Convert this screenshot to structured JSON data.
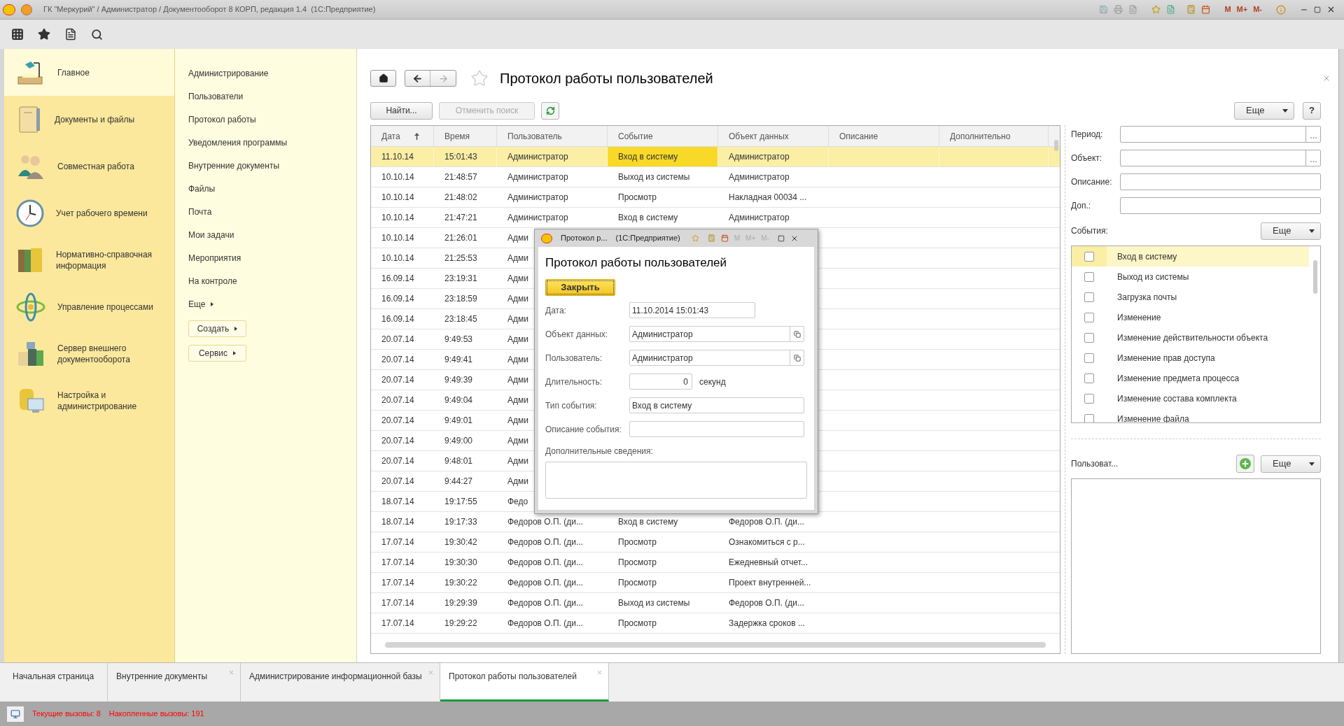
{
  "window": {
    "title": "ГК \"Меркурий\" / Администратор / Документооборот 8 КОРП, редакция 1.4  (1С:Предприятие)",
    "memory_buttons": [
      "M",
      "M+",
      "M-"
    ]
  },
  "sections": [
    {
      "label": "Главное",
      "selected": true
    },
    {
      "label": "Документы и файлы",
      "selected": false
    },
    {
      "label": "Совместная работа",
      "selected": false
    },
    {
      "label": "Учет рабочего времени",
      "selected": false
    },
    {
      "label": "Нормативно-справочная информация",
      "selected": false
    },
    {
      "label": "Управление процессами",
      "selected": false
    },
    {
      "label": "Сервер внешнего документооборота",
      "selected": false
    },
    {
      "label": "Настройка и администрирование",
      "selected": false
    }
  ],
  "nav": {
    "links": [
      "Администрирование",
      "Пользователи",
      "Протокол работы",
      "Уведомления программы",
      "Внутренние документы",
      "Файлы",
      "Почта",
      "Мои задачи",
      "Мероприятия",
      "На контроле"
    ],
    "more": "Еще",
    "buttons": [
      "Создать",
      "Сервис"
    ]
  },
  "page": {
    "title": "Протокол работы пользователей"
  },
  "toolbar": {
    "find": "Найти...",
    "cancel_search": {
      "label": "Отменить поиск",
      "disabled": true
    },
    "more": "Еще",
    "help": "?"
  },
  "table": {
    "columns": [
      {
        "label": "Дата",
        "sorted": true
      },
      {
        "label": "Время",
        "sorted": false
      },
      {
        "label": "Пользователь",
        "sorted": false
      },
      {
        "label": "Событие",
        "sorted": false
      },
      {
        "label": "Объект данных",
        "sorted": false
      },
      {
        "label": "Описание",
        "sorted": false
      },
      {
        "label": "Дополнительно",
        "sorted": false
      }
    ],
    "rows": [
      {
        "date": "11.10.14",
        "time": "15:01:43",
        "user": "Администратор",
        "event": "Вход в систему",
        "object": "Администратор",
        "selected": true
      },
      {
        "date": "10.10.14",
        "time": "21:48:57",
        "user": "Администратор",
        "event": "Выход из системы",
        "object": "Администратор",
        "selected": false
      },
      {
        "date": "10.10.14",
        "time": "21:48:02",
        "user": "Администратор",
        "event": "Просмотр",
        "object": "Накладная 00034 ...",
        "selected": false
      },
      {
        "date": "10.10.14",
        "time": "21:47:21",
        "user": "Администратор",
        "event": "Вход в систему",
        "object": "Администратор",
        "selected": false
      },
      {
        "date": "10.10.14",
        "time": "21:26:01",
        "user": "Адми",
        "selected": false
      },
      {
        "date": "10.10.14",
        "time": "21:25:53",
        "user": "Адми",
        "selected": false
      },
      {
        "date": "16.09.14",
        "time": "23:19:31",
        "user": "Адми",
        "selected": false
      },
      {
        "date": "16.09.14",
        "time": "23:18:59",
        "user": "Адми",
        "selected": false
      },
      {
        "date": "16.09.14",
        "time": "23:18:45",
        "user": "Адми",
        "selected": false
      },
      {
        "date": "20.07.14",
        "time": "9:49:53",
        "user": "Адми",
        "selected": false
      },
      {
        "date": "20.07.14",
        "time": "9:49:41",
        "user": "Адми",
        "selected": false
      },
      {
        "date": "20.07.14",
        "time": "9:49:39",
        "user": "Адми",
        "selected": false
      },
      {
        "date": "20.07.14",
        "time": "9:49:04",
        "user": "Адми",
        "selected": false
      },
      {
        "date": "20.07.14",
        "time": "9:49:01",
        "user": "Адми",
        "selected": false
      },
      {
        "date": "20.07.14",
        "time": "9:49:00",
        "user": "Адми",
        "selected": false
      },
      {
        "date": "20.07.14",
        "time": "9:48:01",
        "user": "Адми",
        "selected": false
      },
      {
        "date": "20.07.14",
        "time": "9:44:27",
        "user": "Адми",
        "selected": false
      },
      {
        "date": "18.07.14",
        "time": "19:17:55",
        "user": "Федо",
        "selected": false
      },
      {
        "date": "18.07.14",
        "time": "19:17:33",
        "user": "Федоров О.П. (ди...",
        "event": "Вход в систему",
        "object": "Федоров О.П. (ди...",
        "selected": false
      },
      {
        "date": "17.07.14",
        "time": "19:30:42",
        "user": "Федоров О.П. (ди...",
        "event": "Просмотр",
        "object": "Ознакомиться с р...",
        "selected": false
      },
      {
        "date": "17.07.14",
        "time": "19:30:30",
        "user": "Федоров О.П. (ди...",
        "event": "Просмотр",
        "object": "Ежедневный отчет...",
        "selected": false
      },
      {
        "date": "17.07.14",
        "time": "19:30:22",
        "user": "Федоров О.П. (ди...",
        "event": "Просмотр",
        "object": "Проект внутренней...",
        "selected": false
      },
      {
        "date": "17.07.14",
        "time": "19:29:39",
        "user": "Федоров О.П. (ди...",
        "event": "Выход из системы",
        "object": "Федоров О.П. (ди...",
        "selected": false
      },
      {
        "date": "17.07.14",
        "time": "19:29:22",
        "user": "Федоров О.П. (ди...",
        "event": "Просмотр",
        "object": "Задержка сроков ...",
        "selected": false
      }
    ]
  },
  "filters": [
    {
      "label": "Период:",
      "kind": "choice"
    },
    {
      "label": "Объект:",
      "kind": "choice"
    },
    {
      "label": "Описание:",
      "kind": "text"
    },
    {
      "label": "Доп.:",
      "kind": "text"
    }
  ],
  "events": {
    "label": "События:",
    "more": "Еще",
    "items": [
      {
        "label": "Вход в систему",
        "checked": false,
        "selected": true
      },
      {
        "label": "Выход из системы",
        "checked": false,
        "selected": false
      },
      {
        "label": "Загрузка почты",
        "checked": false,
        "selected": false
      },
      {
        "label": "Изменение",
        "checked": false,
        "selected": false
      },
      {
        "label": "Изменение действительности объекта",
        "checked": false,
        "selected": false
      },
      {
        "label": "Изменение прав доступа",
        "checked": false,
        "selected": false
      },
      {
        "label": "Изменение предмета процесса",
        "checked": false,
        "selected": false
      },
      {
        "label": "Изменение состава комплекта",
        "checked": false,
        "selected": false
      },
      {
        "label": "Изменение файла",
        "checked": false,
        "selected": false
      }
    ]
  },
  "users": {
    "label": "Пользоват...",
    "more": "Еще"
  },
  "dialog": {
    "title": "Протокол р...",
    "app": "(1С:Предприятие)",
    "memory_buttons": [
      "M",
      "M+",
      "M-"
    ],
    "heading": "Протокол работы пользователей",
    "close": "Закрыть",
    "fields": [
      {
        "label": "Дата:",
        "value": "11.10.2014 15:01:43",
        "kind": "date"
      },
      {
        "label": "Объект данных:",
        "value": "Администратор",
        "kind": "link"
      },
      {
        "label": "Пользователь:",
        "value": "Администратор",
        "kind": "link"
      },
      {
        "label": "Длительность:",
        "value": "0",
        "kind": "number",
        "suffix": "секунд"
      },
      {
        "label": "Тип события:",
        "value": "Вход в систему",
        "kind": "text"
      },
      {
        "label": "Описание события:",
        "kind": "text"
      }
    ],
    "extra_label": "Дополнительные сведения:"
  },
  "tabs": [
    {
      "label": "Начальная страница",
      "closable": false,
      "selected": false
    },
    {
      "label": "Внутренние документы",
      "closable": true,
      "selected": false
    },
    {
      "label": "Администрирование информационной базы",
      "closable": true,
      "selected": false
    },
    {
      "label": "Протокол работы пользователей",
      "closable": true,
      "selected": true
    }
  ],
  "status": {
    "current": "Текущие вызовы: 8",
    "total": "Накопленные вызовы: 191"
  }
}
